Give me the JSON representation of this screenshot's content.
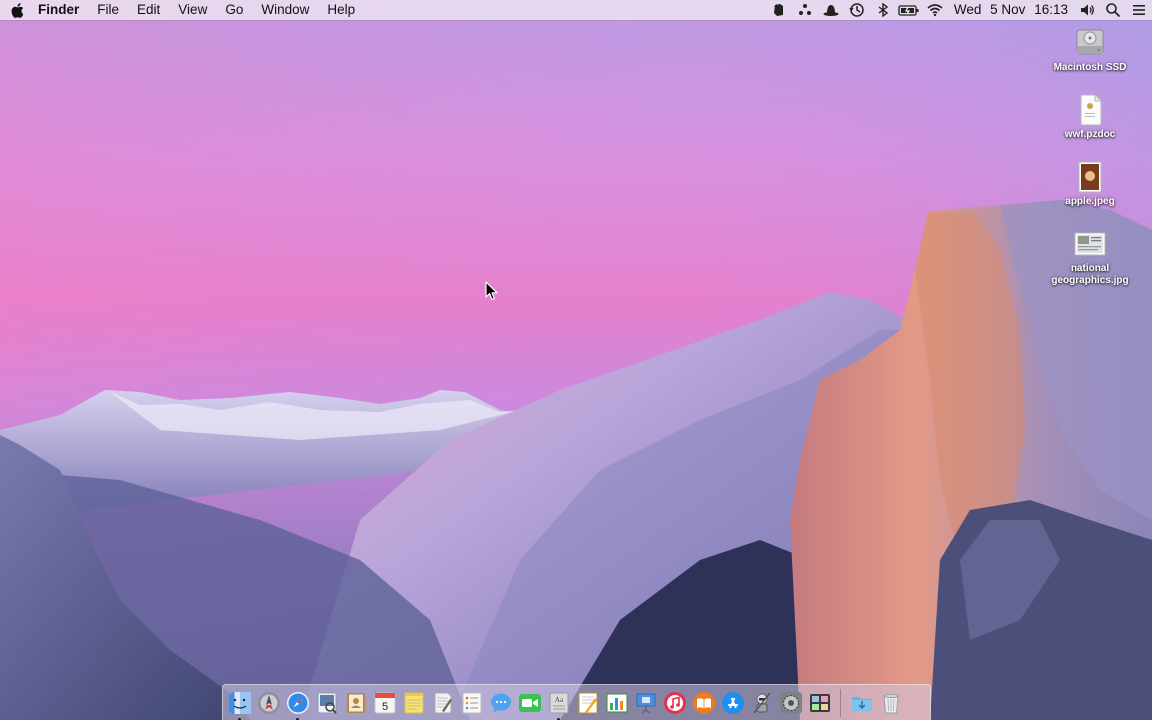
{
  "menubar": {
    "apple_icon": "apple-logo-icon",
    "app_name": "Finder",
    "menus": [
      "File",
      "Edit",
      "View",
      "Go",
      "Window",
      "Help"
    ],
    "status_icons": [
      "evernote-icon",
      "dots-icon",
      "hat-icon",
      "time-machine-icon",
      "bluetooth-icon",
      "battery-icon",
      "wifi-icon"
    ],
    "clock": {
      "day": "Wed",
      "date": "5 Nov",
      "time": "16:13"
    },
    "volume_icon": "volume-icon",
    "spotlight_icon": "spotlight-search-icon",
    "notification_icon": "notification-center-icon"
  },
  "desktop": {
    "icons": [
      {
        "name": "macintosh-ssd",
        "label": "Macintosh SSD",
        "icon": "hard-drive-icon"
      },
      {
        "name": "wwf-pzdoc",
        "label": "wwf.pzdoc",
        "icon": "document-icon"
      },
      {
        "name": "apple-jpeg",
        "label": "apple.jpeg",
        "icon": "image-file-icon"
      },
      {
        "name": "national-geographics",
        "label": "national\ngeographics.jpg",
        "icon": "image-file-icon"
      }
    ]
  },
  "dock": {
    "apps": [
      {
        "name": "finder",
        "icon": "finder-icon",
        "color": "#3d8fe6",
        "running": true
      },
      {
        "name": "launchpad",
        "icon": "launchpad-icon",
        "color": "#8a8f99",
        "running": false
      },
      {
        "name": "safari",
        "icon": "safari-icon",
        "color": "#2e8de8",
        "running": true
      },
      {
        "name": "preview",
        "icon": "preview-icon",
        "color": "#5b7fa8",
        "running": false
      },
      {
        "name": "contacts",
        "icon": "contacts-icon",
        "color": "#b8873e",
        "running": false
      },
      {
        "name": "calendar",
        "icon": "calendar-icon",
        "color": "#f4f4f4",
        "running": false,
        "text": "5"
      },
      {
        "name": "notes",
        "icon": "notes-icon",
        "color": "#f7e27a",
        "running": false
      },
      {
        "name": "textedit",
        "icon": "textedit-icon",
        "color": "#f2f2f2",
        "running": false
      },
      {
        "name": "reminders",
        "icon": "reminders-icon",
        "color": "#f8f8f8",
        "running": false
      },
      {
        "name": "messages",
        "icon": "messages-icon",
        "color": "#4ea3f0",
        "running": false
      },
      {
        "name": "facetime",
        "icon": "facetime-icon",
        "color": "#39c24f",
        "running": false
      },
      {
        "name": "dictionary",
        "icon": "dictionary-icon",
        "color": "#d9d9d9",
        "running": true
      },
      {
        "name": "pages",
        "icon": "pages-icon",
        "color": "#f5a623",
        "running": false
      },
      {
        "name": "numbers",
        "icon": "numbers-icon",
        "color": "#3cb34a",
        "running": false
      },
      {
        "name": "keynote",
        "icon": "keynote-icon",
        "color": "#4a90e2",
        "running": false
      },
      {
        "name": "itunes",
        "icon": "itunes-icon",
        "color": "#e8304d",
        "running": false
      },
      {
        "name": "ibooks",
        "icon": "ibooks-icon",
        "color": "#f07a1e",
        "running": false
      },
      {
        "name": "app-store",
        "icon": "app-store-icon",
        "color": "#1f8ff0",
        "running": false
      },
      {
        "name": "automator",
        "icon": "automator-icon",
        "color": "#9aa3ad",
        "running": false
      },
      {
        "name": "system-preferences",
        "icon": "system-preferences-icon",
        "color": "#7d8288",
        "running": false
      },
      {
        "name": "photo-booth",
        "icon": "photo-booth-icon",
        "color": "#3b3b3b",
        "running": false
      }
    ],
    "stacks": [
      {
        "name": "downloads",
        "icon": "downloads-folder-icon",
        "color": "#5fb2e8"
      },
      {
        "name": "trash",
        "icon": "trash-icon",
        "color": "#d6d8dc"
      }
    ]
  }
}
